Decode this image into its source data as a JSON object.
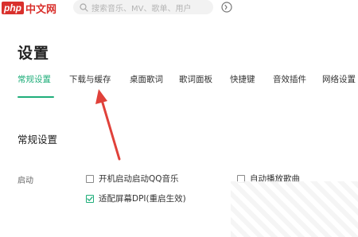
{
  "header": {
    "logo_text_php": "php",
    "logo_text_cn": "中文网",
    "search_placeholder": "搜索音乐、MV、歌单、用户"
  },
  "page": {
    "title": "设置"
  },
  "tabs": [
    {
      "label": "常规设置",
      "active": true
    },
    {
      "label": "下载与缓存",
      "active": false
    },
    {
      "label": "桌面歌词",
      "active": false
    },
    {
      "label": "歌词面板",
      "active": false
    },
    {
      "label": "快捷键",
      "active": false
    },
    {
      "label": "音效插件",
      "active": false
    },
    {
      "label": "网络设置",
      "active": false
    }
  ],
  "section": {
    "title": "常规设置",
    "group_label": "启动",
    "options": [
      {
        "label": "开机启动启动QQ音乐",
        "checked": false
      },
      {
        "label": "自动播放歌曲",
        "checked": false
      },
      {
        "label": "适配屏幕DPI(重启生效)",
        "checked": true
      }
    ]
  },
  "colors": {
    "accent": "#1fae7a",
    "arrow": "#e0413a"
  },
  "icons": {
    "search": "search-icon",
    "voice": "voice-icon",
    "check": "check-icon"
  }
}
